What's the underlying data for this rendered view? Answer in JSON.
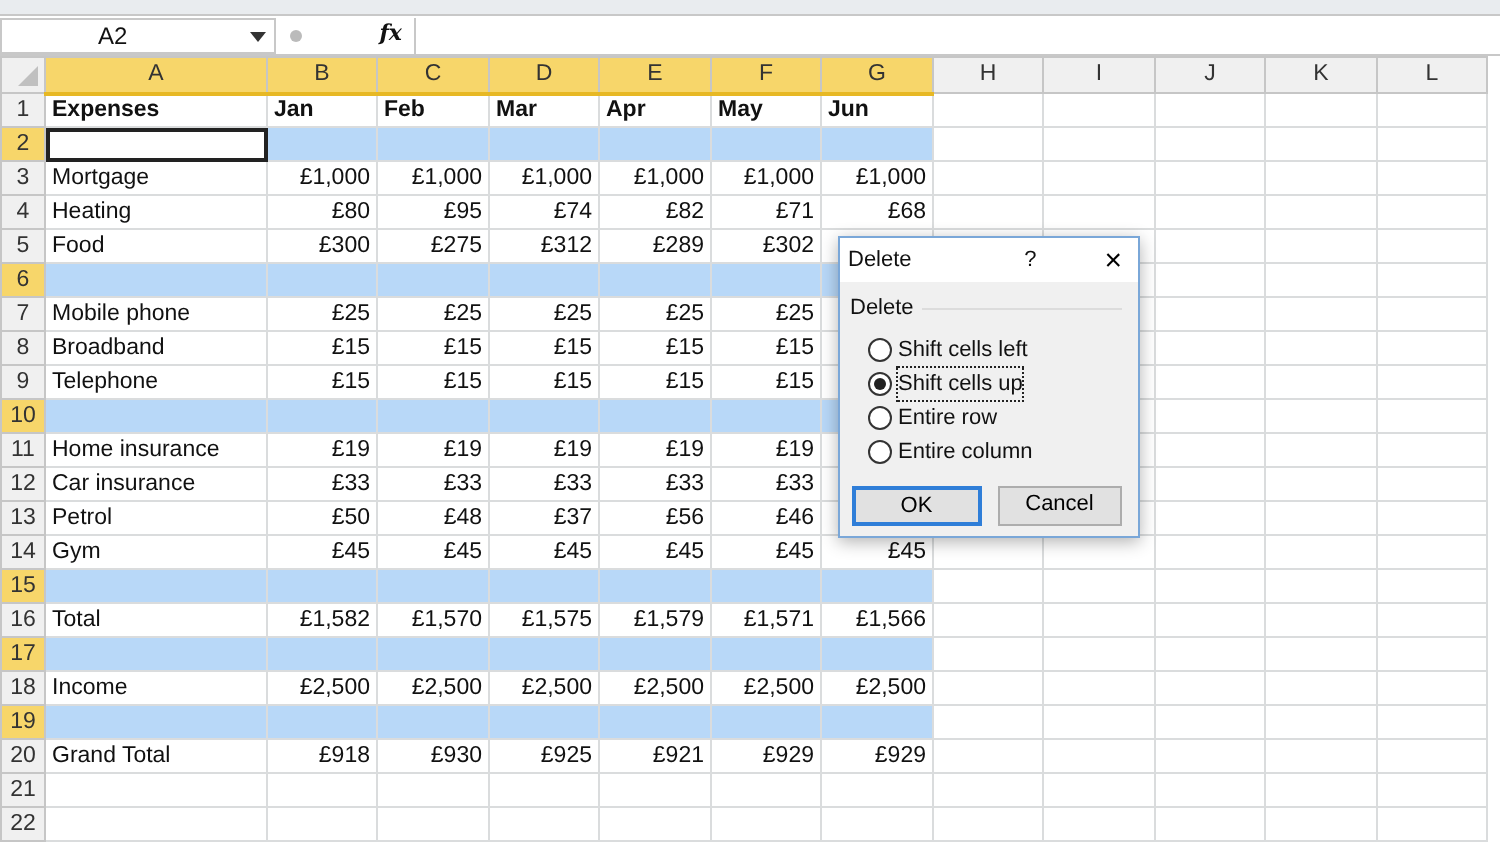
{
  "name_box": {
    "value": "A2"
  },
  "formula_bar": {
    "function_label": "fx"
  },
  "columns": [
    {
      "label": "A",
      "selected": true
    },
    {
      "label": "B",
      "selected": true
    },
    {
      "label": "C",
      "selected": true
    },
    {
      "label": "D",
      "selected": true
    },
    {
      "label": "E",
      "selected": true
    },
    {
      "label": "F",
      "selected": true
    },
    {
      "label": "G",
      "selected": true
    },
    {
      "label": "H",
      "selected": false
    },
    {
      "label": "I",
      "selected": false
    },
    {
      "label": "J",
      "selected": false
    },
    {
      "label": "K",
      "selected": false
    },
    {
      "label": "L",
      "selected": false
    }
  ],
  "rows": [
    {
      "number": "1",
      "kind": "heading",
      "selected": false,
      "active": false,
      "cells": [
        "Expenses",
        "Jan",
        "Feb",
        "Mar",
        "Apr",
        "May",
        "Jun"
      ]
    },
    {
      "number": "2",
      "kind": "blank",
      "selected": true,
      "active": true,
      "cells": []
    },
    {
      "number": "3",
      "kind": "data",
      "selected": false,
      "active": false,
      "cells": [
        "Mortgage",
        "£1,000",
        "£1,000",
        "£1,000",
        "£1,000",
        "£1,000",
        "£1,000"
      ]
    },
    {
      "number": "4",
      "kind": "data",
      "selected": false,
      "active": false,
      "cells": [
        "Heating",
        "£80",
        "£95",
        "£74",
        "£82",
        "£71",
        "£68"
      ]
    },
    {
      "number": "5",
      "kind": "data",
      "selected": false,
      "active": false,
      "cells": [
        "Food",
        "£300",
        "£275",
        "£312",
        "£289",
        "£302"
      ]
    },
    {
      "number": "6",
      "kind": "blank",
      "selected": true,
      "active": false,
      "cells": []
    },
    {
      "number": "7",
      "kind": "data",
      "selected": false,
      "active": false,
      "cells": [
        "Mobile phone",
        "£25",
        "£25",
        "£25",
        "£25",
        "£25"
      ]
    },
    {
      "number": "8",
      "kind": "data",
      "selected": false,
      "active": false,
      "cells": [
        "Broadband",
        "£15",
        "£15",
        "£15",
        "£15",
        "£15"
      ]
    },
    {
      "number": "9",
      "kind": "data",
      "selected": false,
      "active": false,
      "cells": [
        "Telephone",
        "£15",
        "£15",
        "£15",
        "£15",
        "£15"
      ]
    },
    {
      "number": "10",
      "kind": "blank",
      "selected": true,
      "active": false,
      "cells": []
    },
    {
      "number": "11",
      "kind": "data",
      "selected": false,
      "active": false,
      "cells": [
        "Home insurance",
        "£19",
        "£19",
        "£19",
        "£19",
        "£19"
      ]
    },
    {
      "number": "12",
      "kind": "data",
      "selected": false,
      "active": false,
      "cells": [
        "Car insurance",
        "£33",
        "£33",
        "£33",
        "£33",
        "£33"
      ]
    },
    {
      "number": "13",
      "kind": "data",
      "selected": false,
      "active": false,
      "cells": [
        "Petrol",
        "£50",
        "£48",
        "£37",
        "£56",
        "£46"
      ]
    },
    {
      "number": "14",
      "kind": "data",
      "selected": false,
      "active": false,
      "cells": [
        "Gym",
        "£45",
        "£45",
        "£45",
        "£45",
        "£45",
        "£45"
      ]
    },
    {
      "number": "15",
      "kind": "blank",
      "selected": true,
      "active": false,
      "cells": []
    },
    {
      "number": "16",
      "kind": "data",
      "selected": false,
      "active": false,
      "cells": [
        "Total",
        "£1,582",
        "£1,570",
        "£1,575",
        "£1,579",
        "£1,571",
        "£1,566"
      ]
    },
    {
      "number": "17",
      "kind": "blank",
      "selected": true,
      "active": false,
      "cells": []
    },
    {
      "number": "18",
      "kind": "data",
      "selected": false,
      "active": false,
      "cells": [
        "Income",
        "£2,500",
        "£2,500",
        "£2,500",
        "£2,500",
        "£2,500",
        "£2,500"
      ]
    },
    {
      "number": "19",
      "kind": "blank",
      "selected": true,
      "active": false,
      "cells": []
    },
    {
      "number": "20",
      "kind": "data",
      "selected": false,
      "active": false,
      "cells": [
        "Grand Total",
        "£918",
        "£930",
        "£925",
        "£921",
        "£929",
        "£929"
      ]
    },
    {
      "number": "21",
      "kind": "blank",
      "selected": false,
      "active": false,
      "cells": []
    },
    {
      "number": "22",
      "kind": "blank",
      "selected": false,
      "active": false,
      "cells": []
    }
  ],
  "dialog": {
    "title": "Delete",
    "help": "?",
    "close": "×",
    "group_label": "Delete",
    "options": [
      {
        "label": "Shift cells left",
        "selected": false,
        "focused": false
      },
      {
        "label": "Shift cells up",
        "selected": true,
        "focused": true
      },
      {
        "label": "Entire row",
        "selected": false,
        "focused": false
      },
      {
        "label": "Entire column",
        "selected": false,
        "focused": false
      }
    ],
    "buttons": [
      {
        "label": "OK",
        "default": true
      },
      {
        "label": "Cancel",
        "default": false
      }
    ]
  }
}
